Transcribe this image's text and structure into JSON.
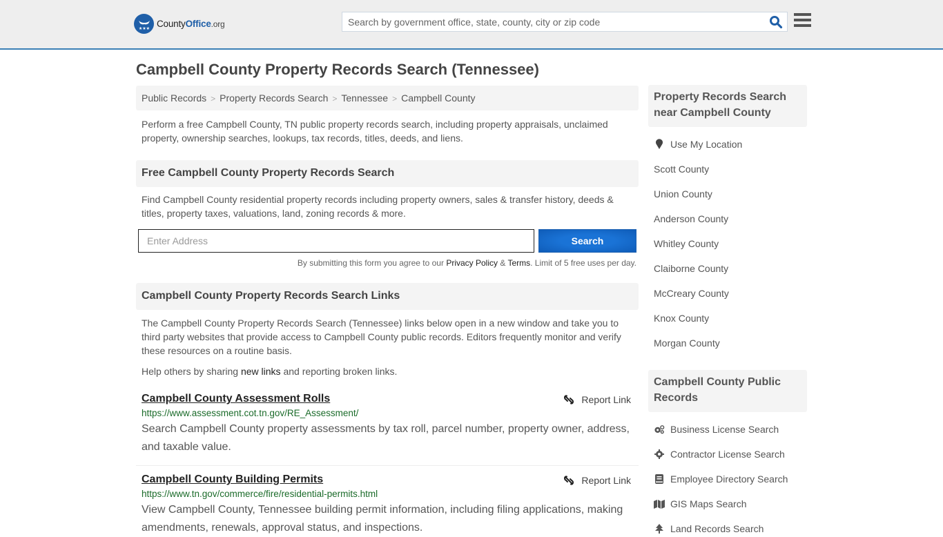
{
  "header": {
    "logo": {
      "county": "County",
      "office": "Office",
      "tld": ".org"
    },
    "search_placeholder": "Search by government office, state, county, city or zip code",
    "colors": {
      "brand_blue": "#1f5fa8",
      "header_bg": "#eeeeee",
      "header_border": "#3b7fb5"
    }
  },
  "page": {
    "title": "Campbell County Property Records Search (Tennessee)",
    "breadcrumb": [
      "Public Records",
      "Property Records Search",
      "Tennessee",
      "Campbell County"
    ],
    "breadcrumb_sep": ">",
    "intro": "Perform a free Campbell County, TN public property records search, including property appraisals, unclaimed property, ownership searches, lookups, tax records, titles, deeds, and liens."
  },
  "free_search": {
    "heading": "Free Campbell County Property Records Search",
    "description": "Find Campbell County residential property records including property owners, sales & transfer history, deeds & titles, property taxes, valuations, land, zoning records & more.",
    "address_placeholder": "Enter Address",
    "button_label": "Search",
    "disclaimer_prefix": "By submitting this form you agree to our ",
    "privacy_label": "Privacy Policy",
    "amp": " & ",
    "terms_label": "Terms",
    "disclaimer_suffix": ". Limit of 5 free uses per day."
  },
  "links_section": {
    "heading": "Campbell County Property Records Search Links",
    "description": "The Campbell County Property Records Search (Tennessee) links below open in a new window and take you to third party websites that provide access to Campbell County public records. Editors frequently monitor and verify these resources on a routine basis.",
    "help_prefix": "Help others by sharing ",
    "help_link": "new links",
    "help_suffix": " and reporting broken links.",
    "report_label": "Report Link",
    "entries": [
      {
        "title": "Campbell County Assessment Rolls",
        "url": "https://www.assessment.cot.tn.gov/RE_Assessment/",
        "description": "Search Campbell County property assessments by tax roll, parcel number, property owner, address, and taxable value."
      },
      {
        "title": "Campbell County Building Permits",
        "url": "https://www.tn.gov/commerce/fire/residential-permits.html",
        "description": "View Campbell County, Tennessee building permit information, including filing applications, making amendments, renewals, approval status, and inspections."
      }
    ]
  },
  "sidebar": {
    "nearby_heading": "Property Records Search near Campbell County",
    "use_location": "Use My Location",
    "nearby": [
      "Scott County",
      "Union County",
      "Anderson County",
      "Whitley County",
      "Claiborne County",
      "McCreary County",
      "Knox County",
      "Morgan County"
    ],
    "public_heading": "Campbell County Public Records",
    "public_links": [
      {
        "label": "Business License Search",
        "icon": "cogs-icon"
      },
      {
        "label": "Contractor License Search",
        "icon": "gear-icon"
      },
      {
        "label": "Employee Directory Search",
        "icon": "book-icon"
      },
      {
        "label": "GIS Maps Search",
        "icon": "map-icon"
      },
      {
        "label": "Land Records Search",
        "icon": "tree-icon"
      }
    ]
  }
}
